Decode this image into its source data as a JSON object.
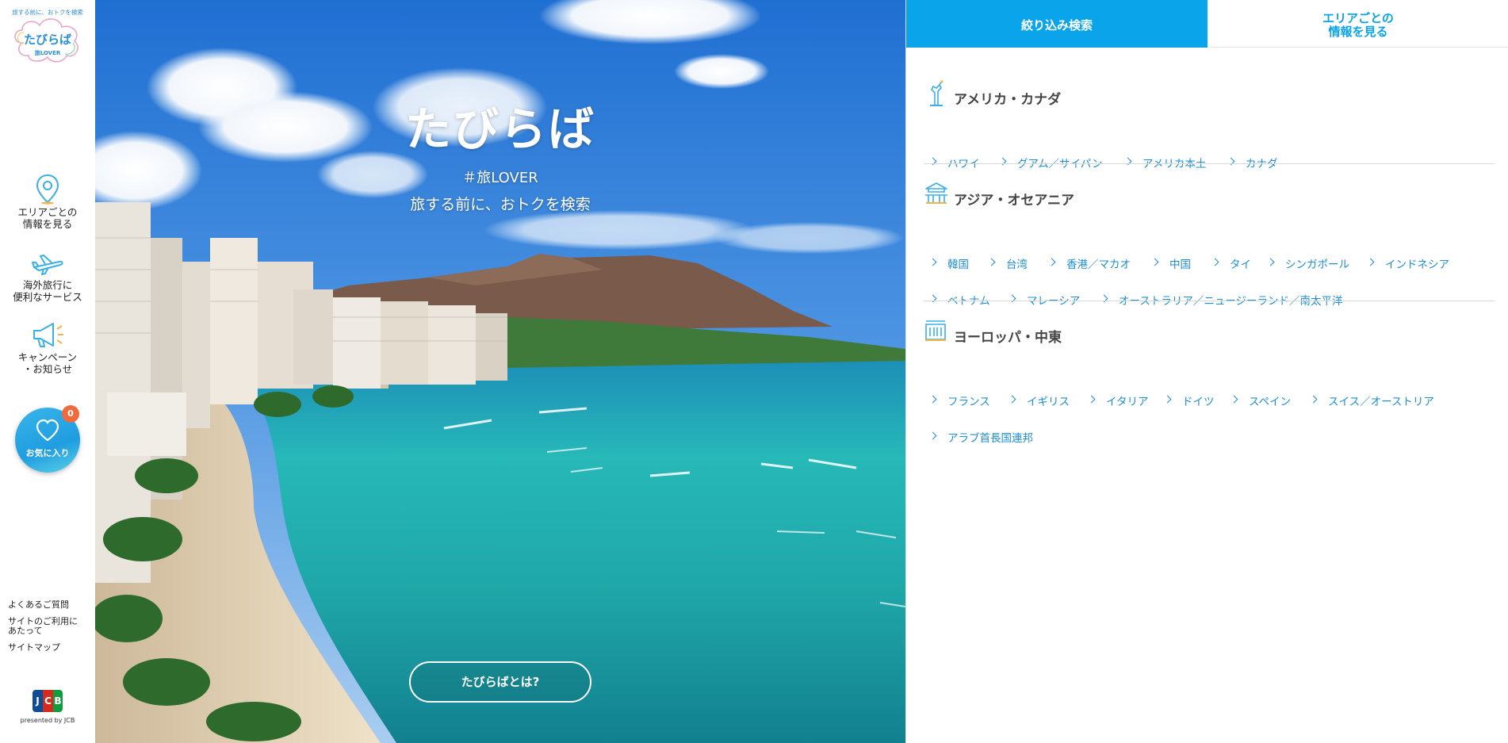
{
  "sidebar": {
    "logo": {
      "arc_text": "旅する前に、おトクを検索",
      "title": "たびらば",
      "sub": "旅LOVER"
    },
    "nav": [
      {
        "label": "エリアごとの\n情報を見る",
        "icon": "map-pin-icon"
      },
      {
        "label": "海外旅行に\n便利なサービス",
        "icon": "airplane-icon"
      },
      {
        "label": "キャンペーン\n・お知らせ",
        "icon": "megaphone-icon"
      }
    ],
    "favorite": {
      "label": "お気に入り",
      "count": "0",
      "icon": "heart-icon"
    },
    "footer_links": [
      "よくあるご質問",
      "サイトのご利用に\nあたって",
      "サイトマップ"
    ],
    "jcb": {
      "logo_letters": [
        "J",
        "C",
        "B"
      ],
      "presented": "presented by JCB"
    },
    "colors": {
      "accent": "#0aa4ea",
      "badge": "#f06a3c"
    }
  },
  "hero": {
    "title": "たびらば",
    "tag": "＃旅LOVER",
    "subtitle": "旅する前に、おトクを検索",
    "button": "たびらばとは?"
  },
  "panel": {
    "tabs": [
      {
        "label": "絞り込み検索",
        "active": true
      },
      {
        "label": "エリアごとの\n情報を見る",
        "active": false
      }
    ],
    "regions": [
      {
        "title": "アメリカ・カナダ",
        "icon": "statue-of-liberty-icon",
        "links": [
          "ハワイ",
          "グアム／サイパン",
          "アメリカ本土",
          "カナダ"
        ]
      },
      {
        "title": "アジア・オセアニア",
        "icon": "asian-temple-icon",
        "links": [
          "韓国",
          "台湾",
          "香港／マカオ",
          "中国",
          "タイ",
          "シンガポール",
          "インドネシア",
          "ベトナム",
          "マレーシア",
          "オーストラリア／ニュージーランド／南太平洋"
        ]
      },
      {
        "title": "ヨーロッパ・中東",
        "icon": "european-building-icon",
        "links": [
          "フランス",
          "イギリス",
          "イタリア",
          "ドイツ",
          "スペイン",
          "スイス／オーストリア",
          "アラブ首長国連邦"
        ]
      }
    ]
  }
}
